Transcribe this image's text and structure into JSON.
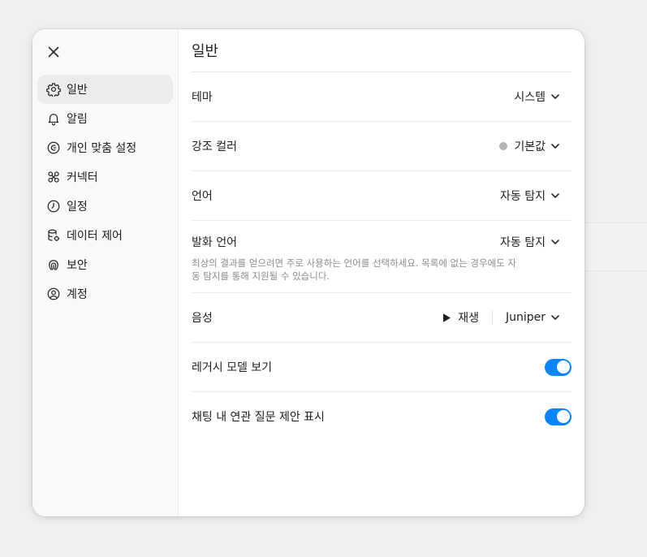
{
  "colors": {
    "accent": "#0a84ff",
    "accent_dot": "#b4b4b4"
  },
  "sidebar": {
    "items": [
      {
        "label": "일반",
        "icon": "gear-icon",
        "active": true
      },
      {
        "label": "알림",
        "icon": "bell-icon"
      },
      {
        "label": "개인 맞춤 설정",
        "icon": "personalize-icon"
      },
      {
        "label": "커넥터",
        "icon": "connector-icon"
      },
      {
        "label": "일정",
        "icon": "clock-icon"
      },
      {
        "label": "데이터 제어",
        "icon": "database-icon"
      },
      {
        "label": "보안",
        "icon": "security-icon"
      },
      {
        "label": "계정",
        "icon": "account-icon"
      }
    ]
  },
  "main": {
    "title": "일반",
    "theme": {
      "label": "테마",
      "value": "시스템"
    },
    "accent_color": {
      "label": "강조 컬러",
      "value": "기본값"
    },
    "language": {
      "label": "언어",
      "value": "자동 탐지"
    },
    "spoken_language": {
      "label": "발화 언어",
      "value": "자동 탐지",
      "description": "최상의 결과를 얻으려면 주로 사용하는 언어를 선택하세요. 목록에 없는 경우에도 자동 탐지를 통해 지원될 수 있습니다."
    },
    "voice": {
      "label": "음성",
      "play_label": "재생",
      "value": "Juniper"
    },
    "legacy_models": {
      "label": "레거시 모델 보기",
      "enabled": true
    },
    "related_questions": {
      "label": "채팅 내 연관 질문 제안 표시",
      "enabled": true
    }
  }
}
